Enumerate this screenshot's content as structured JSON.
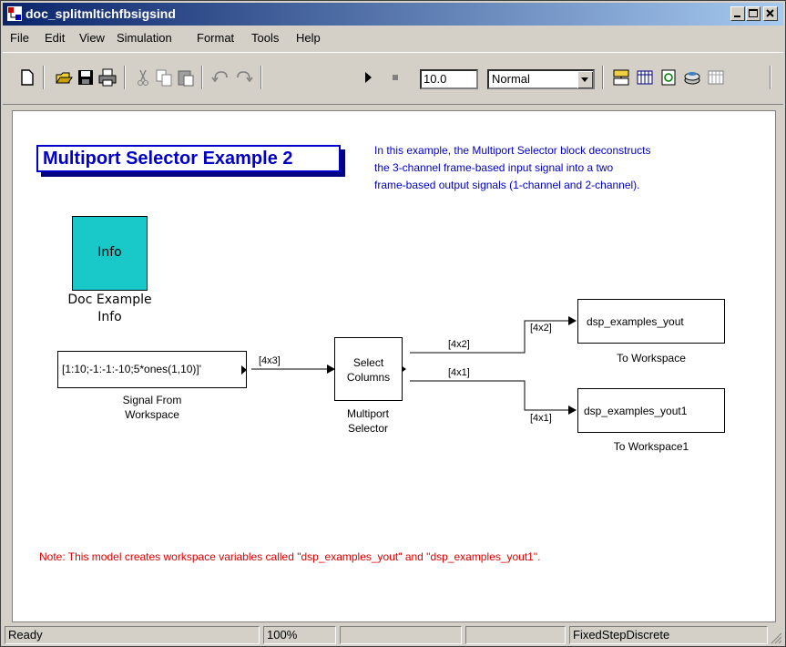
{
  "window": {
    "title": "doc_splitmltichfbsigsind"
  },
  "menu": [
    "File",
    "Edit",
    "View",
    "Simulation",
    "Format",
    "Tools",
    "Help"
  ],
  "toolbar": {
    "stop_time": "10.0",
    "sim_mode": "Normal",
    "icons": [
      "new-icon",
      "open-icon",
      "save-icon",
      "print-icon",
      "cut-icon",
      "copy-icon",
      "paste-icon",
      "undo-icon",
      "redo-icon",
      "start-icon",
      "stop-icon",
      "library-browser-icon",
      "model-explorer-icon",
      "update-diagram-icon",
      "build-icon",
      "debug-icon"
    ]
  },
  "diagram": {
    "title": "Multiport Selector Example 2",
    "description": [
      "In this example, the Multiport Selector block deconstructs",
      "the 3-channel frame-based input signal into a two",
      "frame-based output signals (1-channel and 2-channel)."
    ],
    "info_block": {
      "text": "Info",
      "caption_1": "Doc Example",
      "caption_2": "Info"
    },
    "signal_from_workspace": {
      "text": "[1:10;-1:-1:-10;5*ones(1,10)]'",
      "caption_1": "Signal From",
      "caption_2": "Workspace"
    },
    "multiport_selector": {
      "text_1": "Select",
      "text_2": "Columns",
      "caption_1": "Multiport",
      "caption_2": "Selector"
    },
    "to_workspace": {
      "text": "dsp_examples_yout",
      "caption": "To Workspace"
    },
    "to_workspace1": {
      "text": "dsp_examples_yout1",
      "caption": "To Workspace1"
    },
    "signals": {
      "input": "[4x3]",
      "out1_src": "[4x2]",
      "out2_src": "[4x1]",
      "out1_dst": "[4x2]",
      "out2_dst": "[4x1]"
    },
    "note": "Note: This model creates workspace variables called \"dsp_examples_yout\" and \"dsp_examples_yout1\"."
  },
  "status": {
    "state": "Ready",
    "zoom": "100%",
    "solver": "FixedStepDiscrete"
  },
  "colors": {
    "title_bar": "#0a246a",
    "info_block": "#19c8c8",
    "description": "#0000c8",
    "note": "#e00000",
    "title_box": "#0000c8"
  }
}
